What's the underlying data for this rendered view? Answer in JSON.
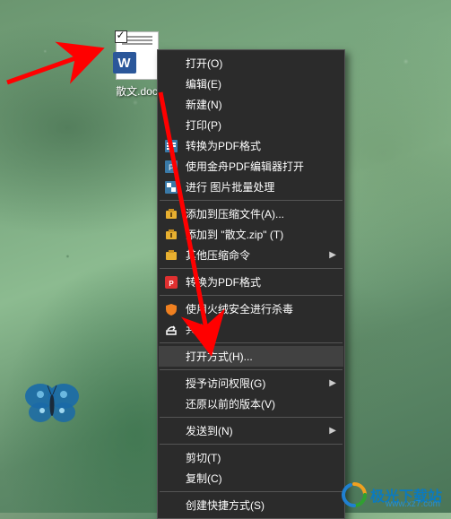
{
  "file": {
    "label": "散文.doc",
    "badge": "W"
  },
  "menu": {
    "open": "打开(O)",
    "edit": "编辑(E)",
    "new": "新建(N)",
    "print": "打印(P)",
    "convert_pdf1": "转换为PDF格式",
    "jinshun_pdf": "使用金舟PDF编辑器打开",
    "batch_image": "进行 图片批量处理",
    "add_archive": "添加到压缩文件(A)...",
    "add_zip": "添加到 \"散文.zip\" (T)",
    "other_compress": "其他压缩命令",
    "convert_pdf2": "转换为PDF格式",
    "huorong": "使用火绒安全进行杀毒",
    "share": "共享",
    "open_with": "打开方式(H)...",
    "grant_access": "授予访问权限(G)",
    "restore_prev": "还原以前的版本(V)",
    "send_to": "发送到(N)",
    "cut": "剪切(T)",
    "copy": "复制(C)",
    "create_shortcut": "创建快捷方式(S)"
  },
  "watermark": {
    "text": "极光下载站",
    "url": "www.xz7.com"
  },
  "colors": {
    "menu_bg": "#2b2b2b",
    "menu_hover": "#414141",
    "arrow_red": "#ff0000",
    "word_blue": "#2b579a"
  }
}
